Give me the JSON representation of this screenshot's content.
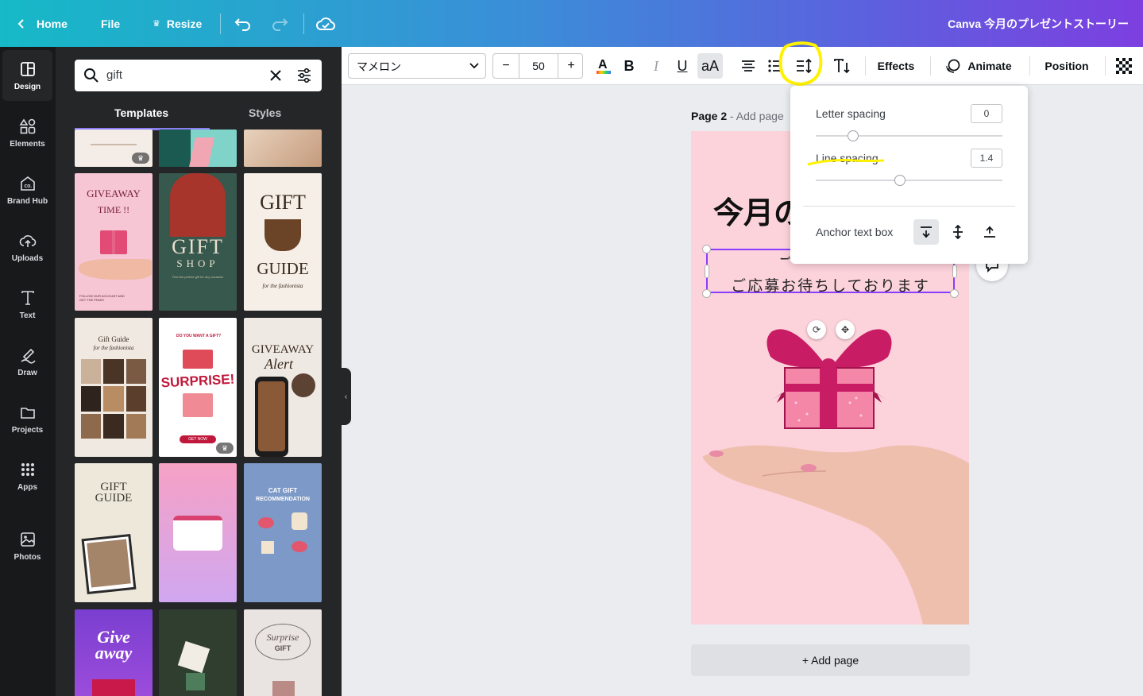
{
  "topbar": {
    "home": "Home",
    "file": "File",
    "resize": "Resize",
    "title": "Canva 今月のプレゼントストーリー"
  },
  "rail": {
    "items": [
      {
        "label": "Design",
        "icon": "layout-icon"
      },
      {
        "label": "Elements",
        "icon": "shapes-icon"
      },
      {
        "label": "Brand Hub",
        "icon": "brand-icon"
      },
      {
        "label": "Uploads",
        "icon": "cloud-upload-icon"
      },
      {
        "label": "Text",
        "icon": "text-icon"
      },
      {
        "label": "Draw",
        "icon": "pen-icon"
      },
      {
        "label": "Projects",
        "icon": "folder-icon"
      },
      {
        "label": "Apps",
        "icon": "apps-grid-icon"
      },
      {
        "label": "Photos",
        "icon": "image-icon"
      }
    ]
  },
  "panel": {
    "search_value": "gift",
    "tabs": [
      "Templates",
      "Styles"
    ],
    "active_tab": "Templates"
  },
  "templates": {
    "t_giveaway_time": {
      "line1": "GIVEAWAY",
      "line2": "TIME !!",
      "footer": "FOLLOW OUR ACCOUNT AND GET THE PRIZE!"
    },
    "t_gift_shop": {
      "line1": "GIFT",
      "line2": "SHOP",
      "sub": "Find the perfect gift for any occasion"
    },
    "t_gift_guide": {
      "line1": "GIFT",
      "line2": "GUIDE",
      "line3": "for the fashionista"
    },
    "t_gift_guide2": {
      "line1": "Gift Guide",
      "line2": "for the fashionista"
    },
    "t_surprise": {
      "top": "DO YOU WANT A GIFT?",
      "main": "SURPRISE!",
      "btn": "GET NOW"
    },
    "t_giveaway_alert": {
      "line1": "GIVEAWAY",
      "line2": "Alert"
    },
    "t_gift_guide3": {
      "line1": "GIFT",
      "line2": "GUIDE"
    },
    "t_cat_gift": {
      "line1": "CAT GIFT",
      "line2": "RECOMMENDATION"
    },
    "t_giveaway_script": {
      "line1": "Give",
      "line2": "away"
    },
    "t_surprise_gift": {
      "line1": "Surprise",
      "line2": "GIFT"
    }
  },
  "toolbar": {
    "font": "マメロン",
    "font_size": "50",
    "minus": "−",
    "plus": "+",
    "case": "aA",
    "effects": "Effects",
    "animate": "Animate",
    "position": "Position"
  },
  "canvas": {
    "page_label": "Page 2",
    "page_sub": " - Add page",
    "title_fragment": "今月の",
    "sub_partial": "ご し ご じ",
    "body_text": "ご応募お待ちしております",
    "add_page": "+ Add page"
  },
  "spacing_popover": {
    "letter_spacing_label": "Letter spacing",
    "letter_spacing_value": "0",
    "letter_spacing_fraction": 0.2,
    "line_spacing_label": "Line spacing",
    "line_spacing_value": "1.4",
    "line_spacing_fraction": 0.45,
    "anchor_label": "Anchor text box"
  },
  "colors": {
    "accent": "#8b3dff",
    "annotation_yellow": "#fff200",
    "page_bg": "#fcd2db",
    "gift_pink": "#c81d64"
  }
}
